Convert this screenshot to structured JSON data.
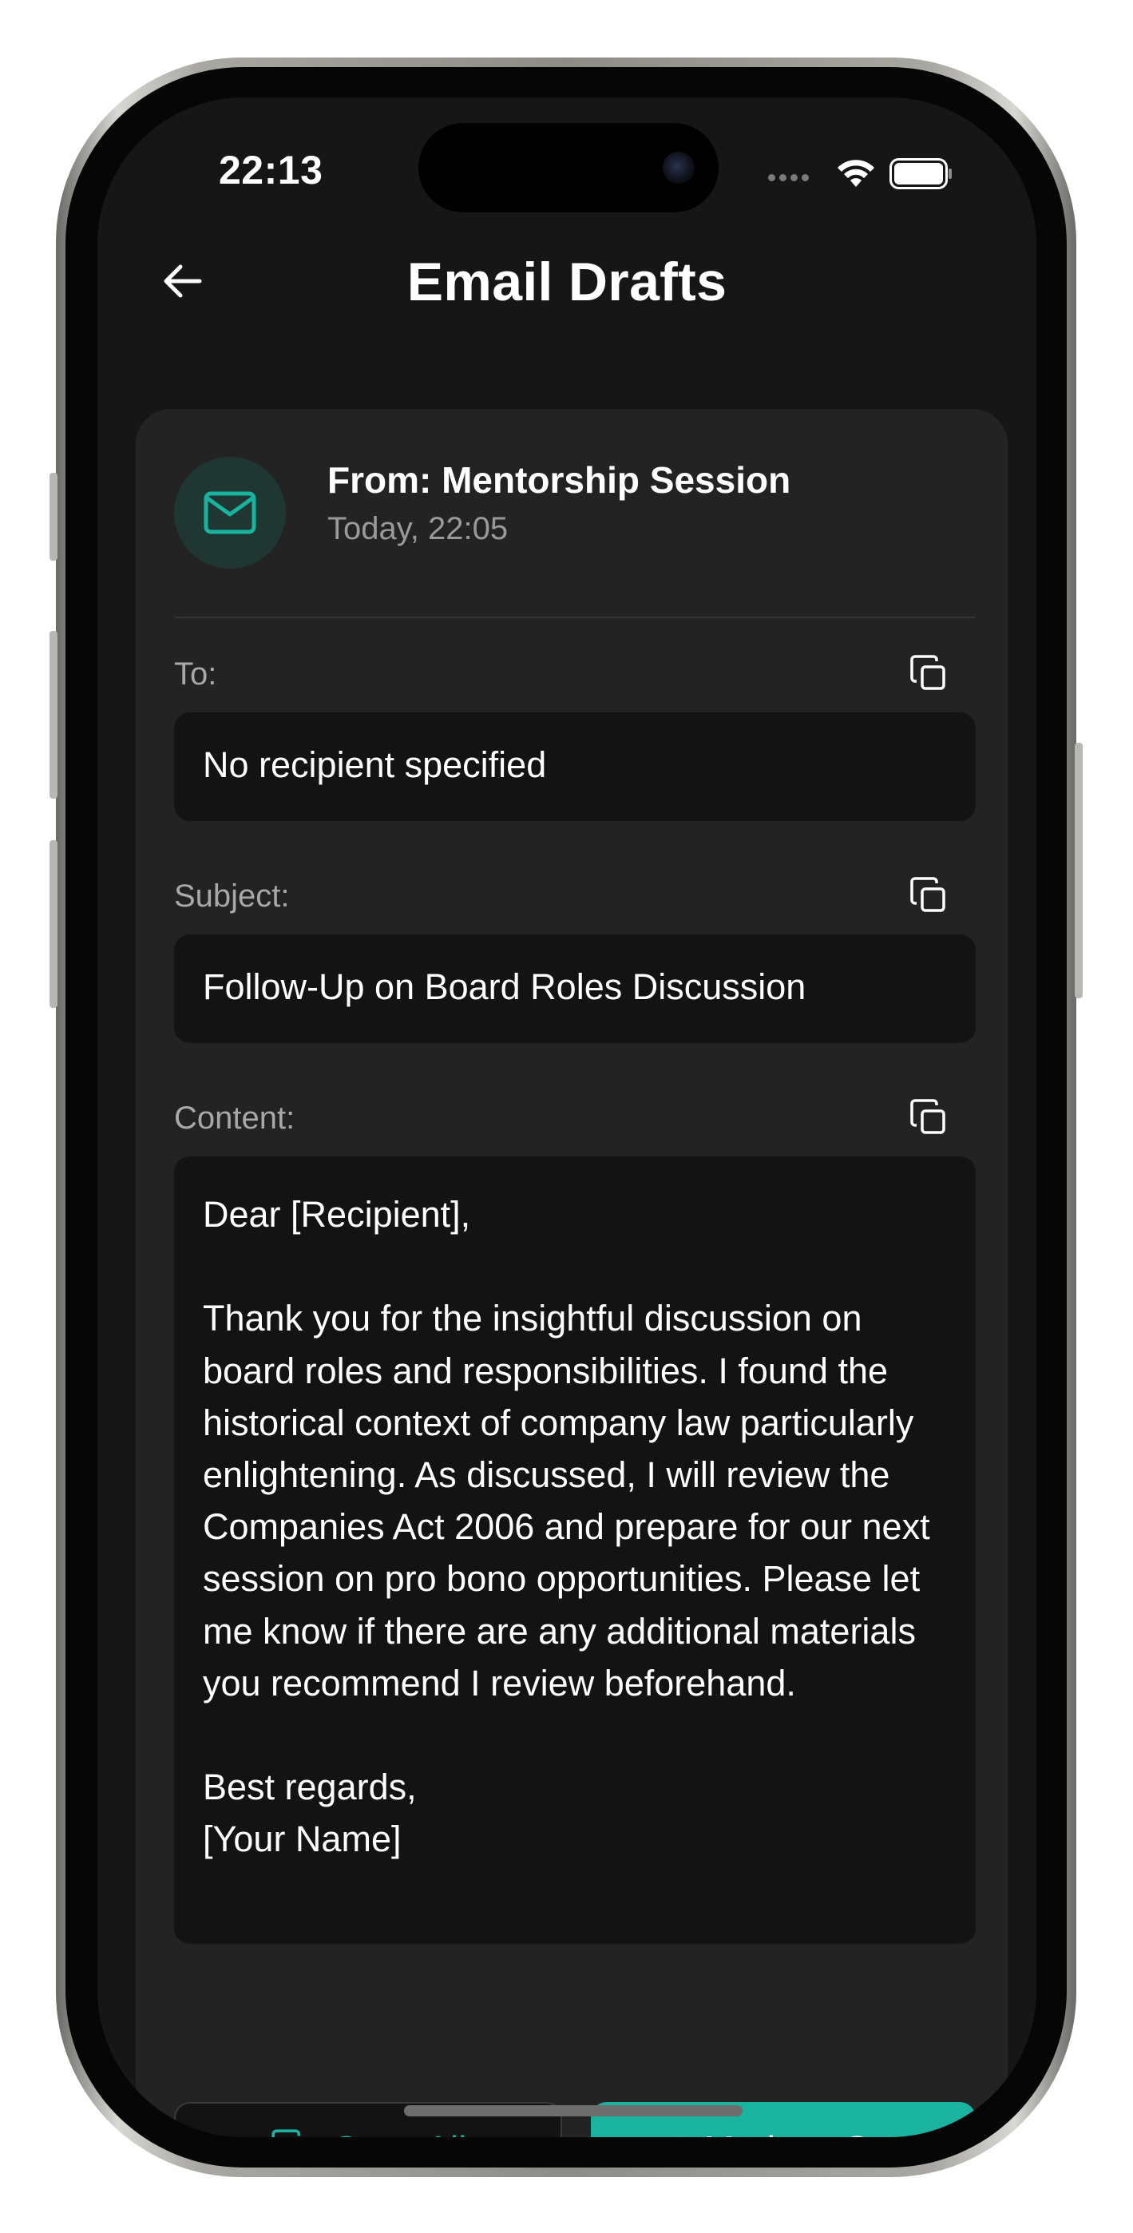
{
  "status_bar": {
    "time": "22:13",
    "icons": [
      "cellular-signal-icon",
      "wifi-icon",
      "battery-icon"
    ]
  },
  "nav": {
    "back_icon": "arrow-left-icon",
    "title": "Email Drafts"
  },
  "draft": {
    "from": "From: Mentorship Session",
    "timestamp": "Today, 22:05",
    "avatar_icon": "mail-icon",
    "fields": {
      "to": {
        "label": "To:",
        "value": "No recipient specified"
      },
      "subject": {
        "label": "Subject:",
        "value": "Follow-Up on Board Roles Discussion"
      },
      "content": {
        "label": "Content:",
        "value": "Dear [Recipient],\n\nThank you for the insightful discussion on board roles and responsibilities. I found the historical context of company law particularly enlightening. As discussed, I will review the Companies Act 2006 and prepare for our next session on pro bono opportunities. Please let me know if there are any additional materials you recommend I review beforehand.\n\nBest regards,\n[Your Name]"
      }
    }
  },
  "actions": {
    "copy_all_label": "Copy All",
    "mark_sent_label": "Mark as Sent"
  },
  "colors": {
    "accent": "#19b3a0",
    "background": "#161616",
    "card": "#232323",
    "field": "#131313"
  }
}
